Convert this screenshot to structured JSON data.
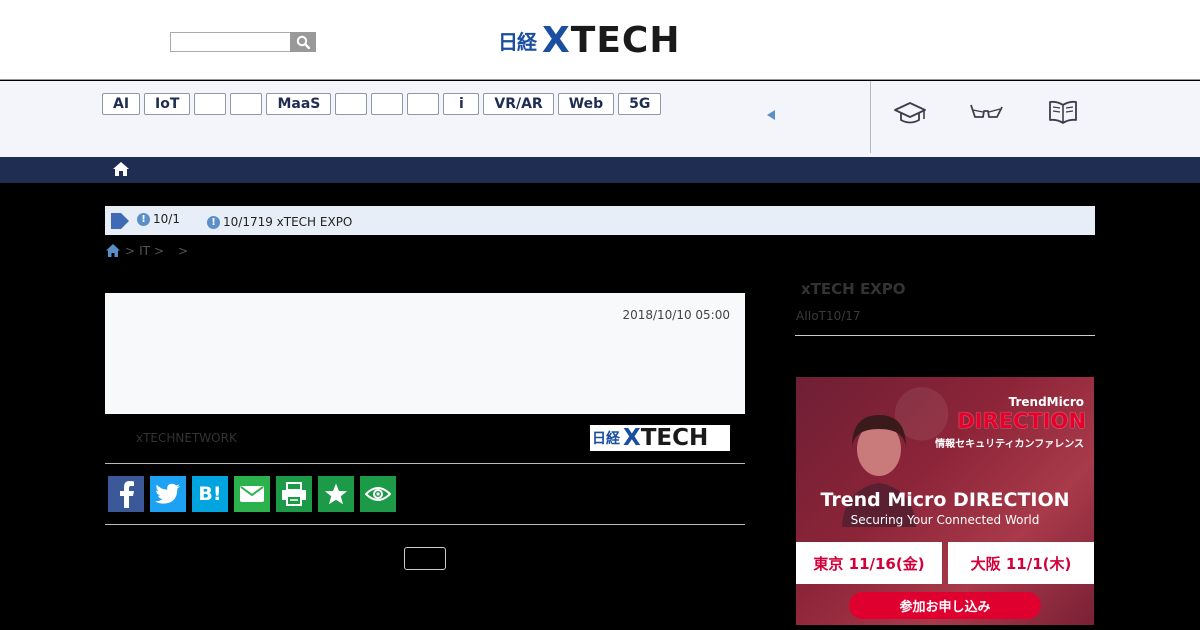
{
  "header": {
    "search": {
      "placeholder": ""
    },
    "logo": {
      "nikkei": "日経",
      "x": "X",
      "tech": "TECH"
    }
  },
  "tags": [
    "AI",
    "IoT",
    "",
    "",
    "MaaS",
    "",
    "",
    "",
    "i",
    "VR/AR",
    "Web",
    "5G"
  ],
  "toolbar_icons": [
    "graduation-cap-icon",
    "glasses-icon",
    "book-icon"
  ],
  "notice": {
    "item1": "10/1",
    "item2": "10/1719 xTECH EXPO"
  },
  "breadcrumb": {
    "sep1": ">",
    "crumb1": "IT",
    "sep2": ">",
    "sep3": ">"
  },
  "article": {
    "date": "2018/10/10 05:00",
    "source": "xTECHNETWORK",
    "source_logo": {
      "nikkei": "日経",
      "x": "X",
      "tech": "TECH"
    }
  },
  "share_buttons": [
    {
      "name": "facebook",
      "color": "#3b5998"
    },
    {
      "name": "twitter",
      "color": "#1da1f2"
    },
    {
      "name": "hatena",
      "color": "#00a4de"
    },
    {
      "name": "mail",
      "color": "#2bb24c"
    },
    {
      "name": "print",
      "color": "#1d9a47"
    },
    {
      "name": "star",
      "color": "#1d9a47"
    },
    {
      "name": "watch",
      "color": "#1d9a47"
    }
  ],
  "sidebar": {
    "title": "xTECH EXPO",
    "subtitle": "AIIoT10/17"
  },
  "ad": {
    "brand": "TrendMicro",
    "direction": "DIRECTION",
    "jp_sub": "情報セキュリティカンファレンス",
    "title": "Trend Micro DIRECTION",
    "tagline": "Securing Your Connected World",
    "city1": "東京 11/16(金)",
    "city2": "大阪 11/1(木)",
    "cta": "参加お申し込み"
  },
  "colors": {
    "nav": "#1f2d52",
    "brand_blue": "#1a4ea0",
    "accent_blue": "#5b8fc8"
  }
}
